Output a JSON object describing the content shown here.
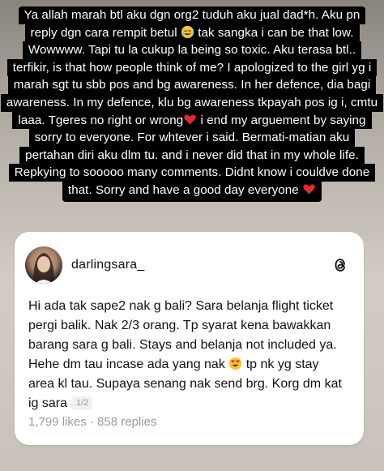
{
  "story": {
    "lines": [
      "Ya allah marah btl aku dgn org2 tuduh aku jual dad*h. Aku pn",
      "reply dgn cara rempit betul",
      "tak sangka i can be that low.",
      "Wowwww. Tapi tu la cukup la being so toxic. Aku terasa btl..",
      "terfikir, is that how people think of me? I apologized to the girl yg i",
      "marah sgt tu sbb pos and bg awareness. In her defence, dia bagi",
      "awareness. In my defence, klu bg awareness tkpayah pos ig i, cmtu",
      "laaa. Tgeres no right or wrong",
      "i end my arguement by saying",
      "sorry to everyone. For whtever i said. Bermati-matian aku",
      "pertahan diri aku dlm tu. and i never did that in my whole life.",
      "Repkying to sooooo many comments. Didnt know i couldve done",
      "that. Sorry and have a good day everyone"
    ],
    "emoji_laugh": "rolling-laughing-emoji",
    "emoji_heart": "red-heart-emoji"
  },
  "post": {
    "username": "darlingsara_",
    "app_icon": "threads-icon",
    "lines": [
      "Hi ada tak sape2 nak g bali? Sara belanja flight ticket",
      "pergi balik. Nak 2/3 orang. Tp syarat kena bawakkan",
      "barang sara g bali. Stays and belanja not included ya.",
      "Hehe dm tau incase ada yang nak",
      "tp nk yg stay",
      "area kl tau. Supaya senang nak send brg. Korg dm kat",
      "ig sara"
    ],
    "emoji_heart_eyes": "heart-eyes-emoji",
    "page_indicator": "1/2",
    "stats": "1,799 likes · 858 replies"
  }
}
